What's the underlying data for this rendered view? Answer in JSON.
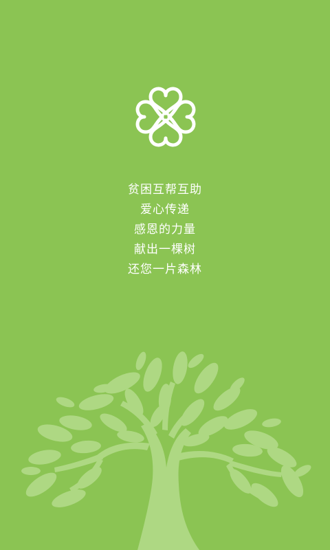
{
  "splash": {
    "logo_icon": "clover-heart-logo-icon",
    "tree_icon": "tree-illustration-icon",
    "slogan": [
      "贫困互帮互助",
      "爱心传递",
      "感恩的力量",
      "献出一棵树",
      "还您一片森林"
    ]
  },
  "colors": {
    "background": "#8bc453",
    "text": "#ffffff",
    "tree": "#aed883"
  }
}
